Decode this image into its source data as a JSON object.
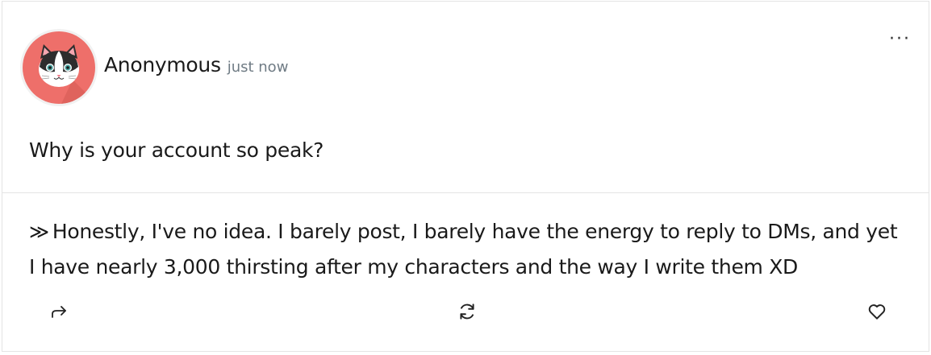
{
  "post": {
    "author": "Anonymous",
    "timestamp": "just now",
    "menu_label": "···",
    "question": "Why is your account so peak?",
    "answer_marker": "≫",
    "answer": "Honestly, I've no idea. I barely post, I barely have the energy to reply to DMs, and yet I have nearly 3,000 thirsting after my characters and the way I write them XD"
  },
  "icons": {
    "avatar": "cat-avatar",
    "share": "share-arrow-icon",
    "repost": "repost-icon",
    "like": "heart-icon",
    "menu": "more-dots-icon"
  },
  "colors": {
    "avatar_bg": "#ee6f6a",
    "timestamp": "#6f7b84",
    "border": "#e4e4e4"
  }
}
